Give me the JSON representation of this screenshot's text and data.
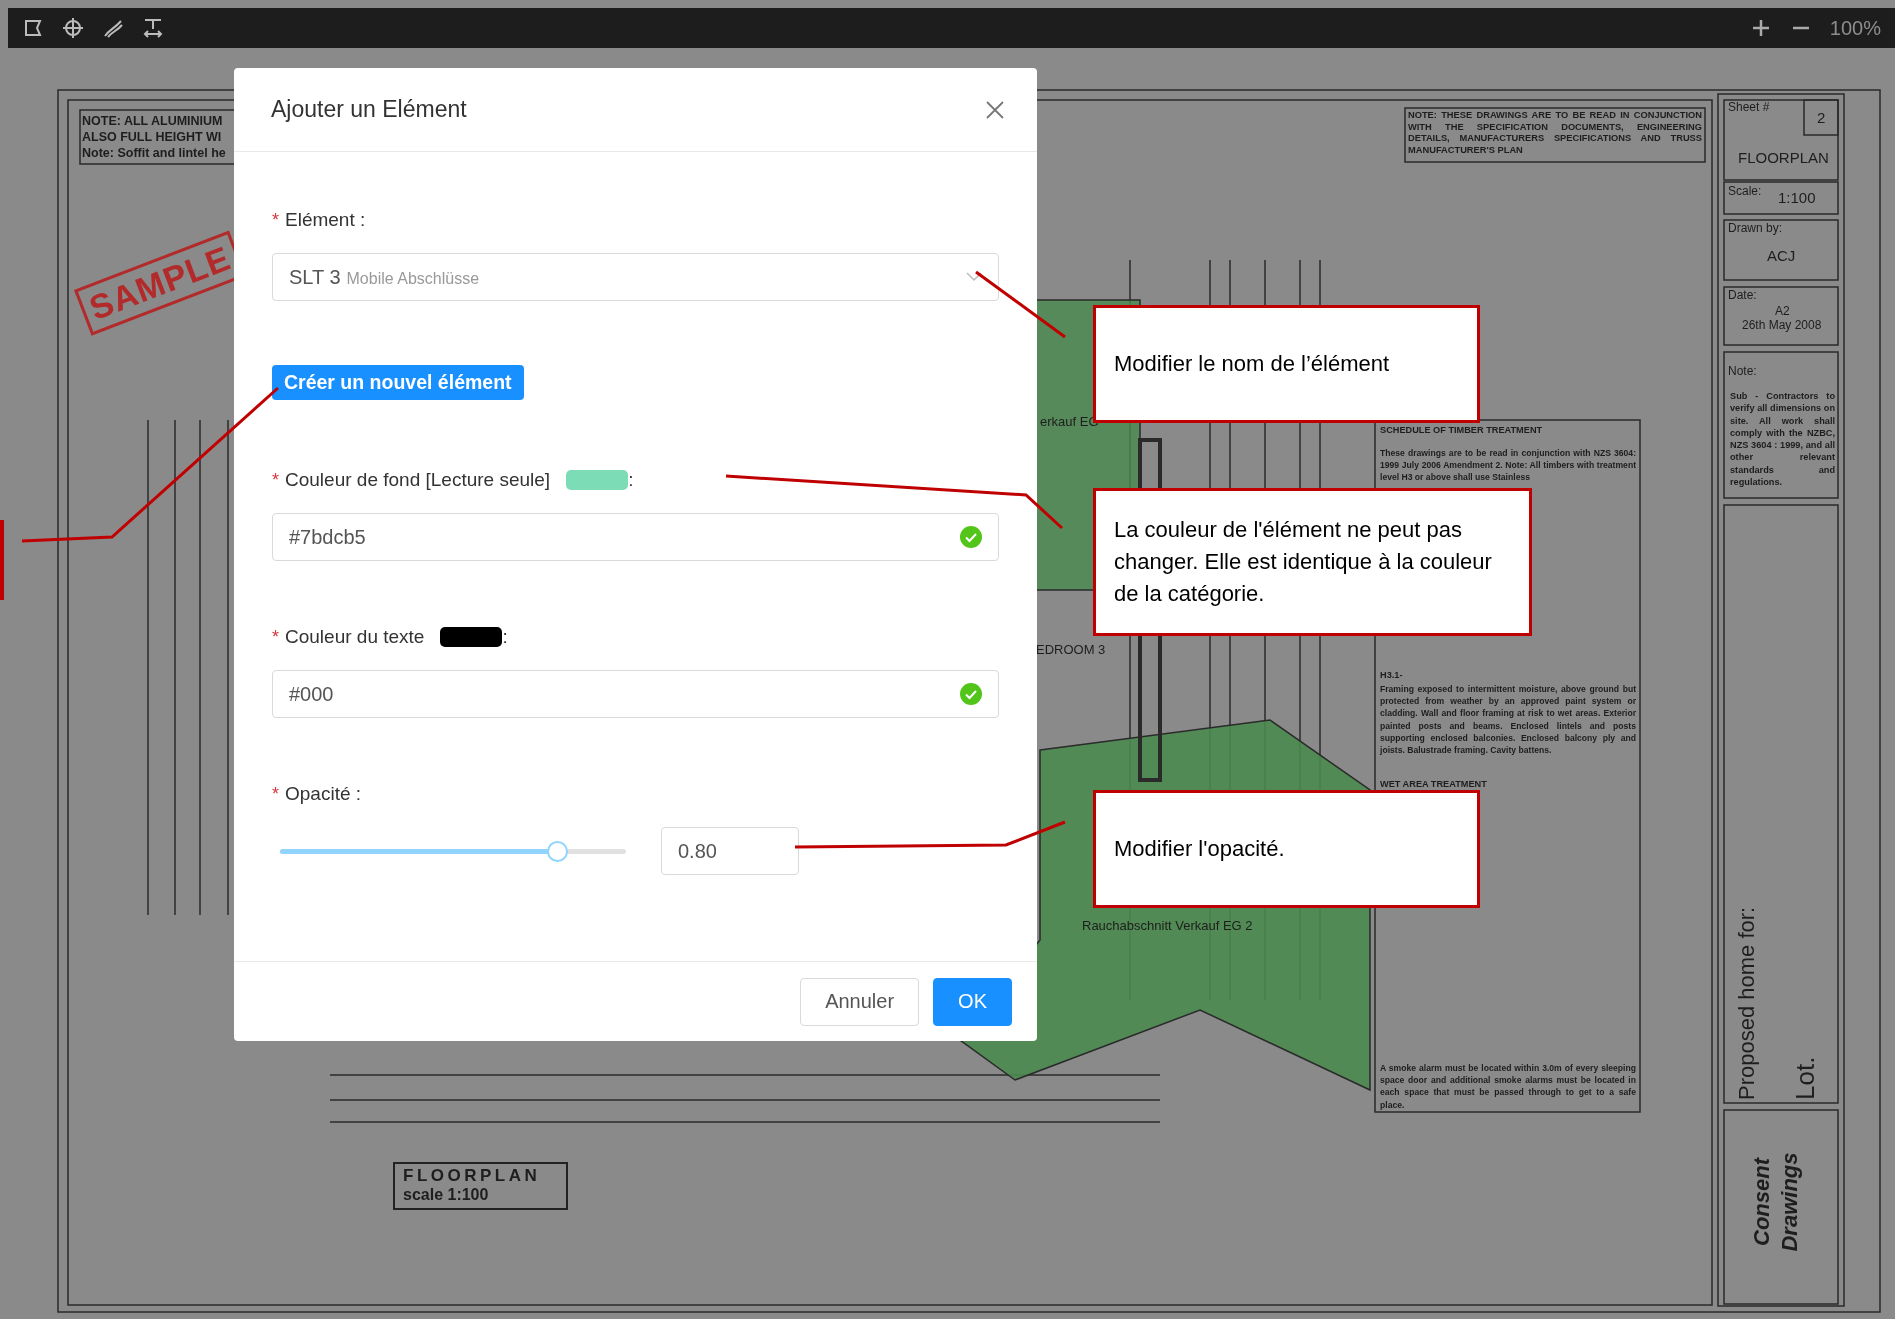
{
  "toolbar": {
    "zoom_level": "100%"
  },
  "drawing": {
    "corner_note": [
      "NOTE: ALL ALUMINIUM",
      "ALSO FULL HEIGHT WI",
      "Note: Soffit and lintel he"
    ],
    "stamp": "SAMPLE",
    "spec_note": "NOTE: THESE DRAWINGS ARE TO BE READ IN CONJUNCTION WITH THE SPECIFICATION DOCUMENTS, ENGINEERING DETAILS, MANUFACTURERS SPECIFICATIONS AND TRUSS MANUFACTURER'S PLAN",
    "room_labels": [
      "erkauf EG",
      "EDROOM 3",
      "Rauchabschnitt Verkauf EG 2"
    ],
    "schedule": [
      {
        "kind": "heading",
        "text": "SCHEDULE OF TIMBER TREATMENT"
      },
      {
        "kind": "text",
        "text": "These drawings are to be read in conjunction with NZS 3604: 1999 July 2006 Amendment 2. Note: All timbers with treatment level H3 or above shall use Stainless"
      },
      {
        "kind": "heading",
        "text": "H3.1-"
      },
      {
        "kind": "text",
        "text": "Framing exposed to intermittent moisture, above ground but protected from weather by an approved paint system or cladding. Wall and floor framing at risk to wet areas. Exterior painted posts and beams. Enclosed lintels and posts supporting enclosed balconies. Enclosed balcony ply and joists. Balustrade framing. Cavity battens."
      },
      {
        "kind": "heading",
        "text": "WET AREA TREATMENT"
      },
      {
        "kind": "text",
        "text": "A smoke alarm must be located within 3.0m of every sleeping space door and additional smoke alarms must be located in each space that must be passed through to get to a safe place."
      }
    ],
    "plan_title": {
      "title": "FLOORPLAN",
      "scale": "scale 1:100"
    },
    "title_block": {
      "sheet_label": "Sheet #",
      "sheet_number": "2",
      "sheet_title": "FLOORPLAN",
      "scale_label": "Scale:",
      "scale": "1:100",
      "drawn_by_label": "Drawn by:",
      "drawn_by": "ACJ",
      "date_label": "Date:",
      "size": "A2",
      "date": "26th May 2008",
      "note_label": "Note:",
      "note": "Sub - Contractors to verify all dimensions on site. All work shall comply with the NZBC, NZS 3604 : 1999, and all other relevant standards and regulations.",
      "project_label": "Proposed home for:",
      "lot": "Lot.",
      "status": "Consent Drawings"
    }
  },
  "dialog": {
    "title": "Ajouter un Elément",
    "fields": [
      {
        "kind": "select",
        "required_mark": "*",
        "label": "Elément :",
        "value": "SLT 3",
        "hint": "Mobile Abschlüsse"
      },
      {
        "kind": "button",
        "label": "Créer un nouvel élément"
      },
      {
        "kind": "color",
        "required_mark": "*",
        "label": "Couleur de fond [Lecture seule]",
        "color": "#7bdcb5",
        "suffix": ":",
        "value": "#7bdcb5",
        "valid": true
      },
      {
        "kind": "color",
        "required_mark": "*",
        "label": "Couleur du texte",
        "color": "#000000",
        "suffix": ":",
        "value": "#000",
        "valid": true
      },
      {
        "kind": "slider",
        "required_mark": "*",
        "label": "Opacité :",
        "level": 0.8,
        "value": "0.80"
      }
    ],
    "buttons": [
      {
        "label": "Annuler",
        "kind": "default"
      },
      {
        "label": "OK",
        "kind": "primary"
      }
    ]
  },
  "callouts": [
    "Modifier le nom de l’élément",
    "La couleur de l'élément ne peut pas changer. Elle est identique à la couleur de la catégorie.",
    "Modifier l'opacité."
  ]
}
